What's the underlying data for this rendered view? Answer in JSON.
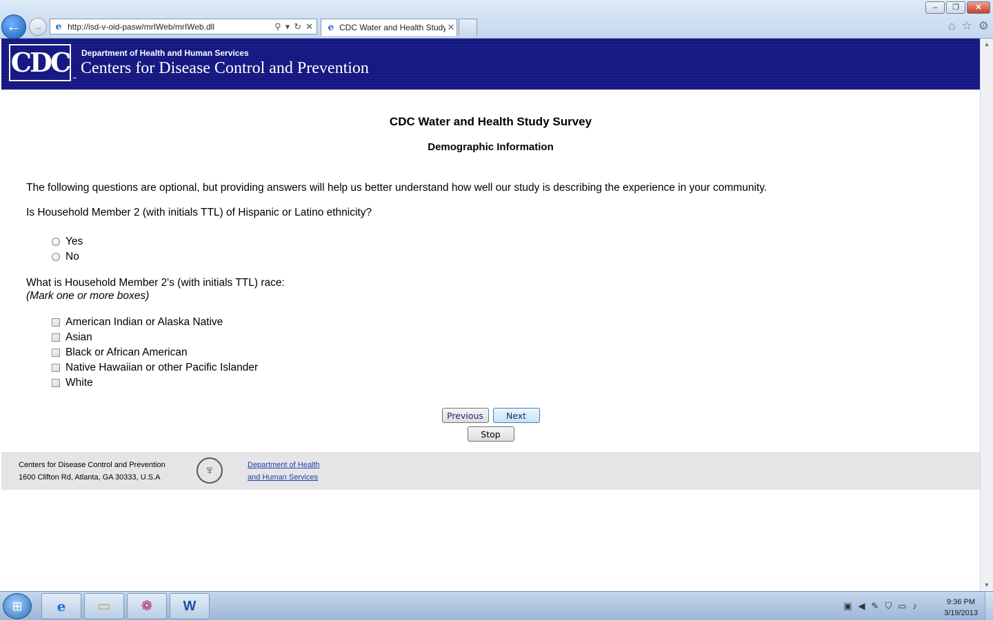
{
  "browser": {
    "address_url": "http://isd-v-oid-pasw/mrIWeb/mrIWeb.dll",
    "tab_title": "CDC Water and Health Study",
    "window_buttons": [
      "–",
      "❐",
      "✕"
    ]
  },
  "banner": {
    "logo_text": "CDC",
    "dept": "Department of Health and Human Services",
    "org_name": "Centers for Disease Control and Prevention"
  },
  "survey": {
    "title": "CDC Water and Health Study Survey",
    "section": "Demographic Information",
    "intro": "The following questions are optional, but providing answers will help us better understand how well our study is describing the experience in your community.",
    "q1": {
      "text": "Is Household Member 2 (with initials TTL) of Hispanic or Latino ethnicity?",
      "options": [
        "Yes",
        "No"
      ]
    },
    "q2": {
      "text": "What is Household Member 2's (with initials TTL) race:",
      "hint": "(Mark one or more boxes)",
      "options": [
        "American Indian or Alaska Native",
        "Asian",
        "Black or African American",
        "Native Hawaiian or other Pacific Islander",
        "White"
      ]
    },
    "buttons": {
      "previous": "Previous",
      "next": "Next",
      "stop": "Stop"
    }
  },
  "footer": {
    "org": "Centers for Disease Control and Prevention",
    "address": "1600 Clifton Rd, Atlanta, GA 30333, U.S.A",
    "link_line1": "Department of Health",
    "link_line2": "and Human Services"
  },
  "taskbar": {
    "time": "9:36 PM",
    "date": "3/19/2013"
  }
}
